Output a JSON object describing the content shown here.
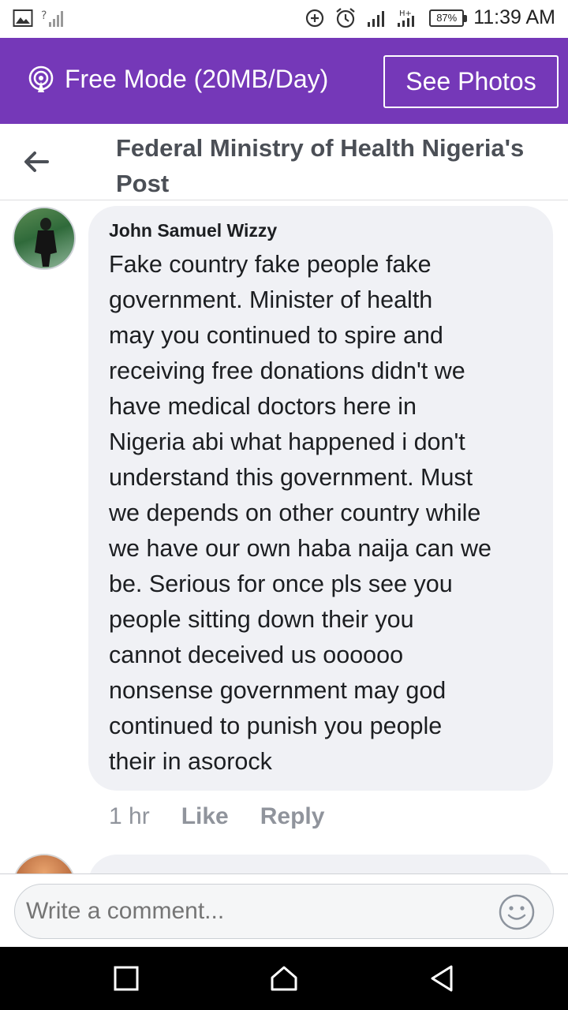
{
  "status_bar": {
    "battery": "87%",
    "time": "11:39 AM"
  },
  "free_mode_bar": {
    "label": "Free Mode (20MB/Day)",
    "see_photos": "See Photos"
  },
  "header": {
    "title": "Federal Ministry of Health Nigeria's Post"
  },
  "comment": {
    "author": "John Samuel Wizzy",
    "text": "Fake country fake people fake\ngovernment.  Minister of health\nmay you continued to spire and\nreceiving free donations didn't we\nhave medical doctors here in\nNigeria abi what happened i don't\nunderstand this government. Must\nwe depends on other country  while\nwe have our own haba naija can we\nbe.  Serious for once pls see you\npeople sitting down their you\ncannot deceived us oooooo\nnonsense government may god\ncontinued to punish you people\ntheir in asorock",
    "time": "1 hr",
    "like": "Like",
    "reply": "Reply"
  },
  "composer": {
    "placeholder": "Write a comment..."
  },
  "icons": {
    "gallery": "gallery-icon",
    "signal": "signal-icon",
    "data_saver": "data-saver-icon",
    "alarm": "alarm-icon",
    "free_mode": "podcast-icon",
    "back": "back-arrow-icon",
    "emoji": "smiley-icon",
    "recents": "square-icon",
    "home": "home-icon",
    "back_nav": "triangle-back-icon"
  },
  "colors": {
    "free_bar": "#7538b8",
    "bubble": "#f0f1f5",
    "header_text": "#4b4f56"
  }
}
